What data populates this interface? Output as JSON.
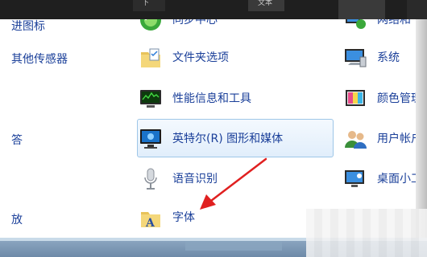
{
  "header": {
    "partial_labels": [
      "下",
      "文本"
    ]
  },
  "left_column": {
    "items": [
      {
        "label": "进图标"
      },
      {
        "label": "其他传感器"
      },
      {
        "label": "答"
      },
      {
        "label": "放"
      }
    ]
  },
  "middle_column": {
    "items": [
      {
        "label": "同步中心",
        "icon": "sync-center-icon"
      },
      {
        "label": "文件夹选项",
        "icon": "folder-options-icon"
      },
      {
        "label": "性能信息和工具",
        "icon": "performance-monitor-icon"
      },
      {
        "label": "英特尔(R) 图形和媒体",
        "icon": "intel-graphics-icon"
      },
      {
        "label": "语音识别",
        "icon": "microphone-icon"
      },
      {
        "label": "字体",
        "icon": "fonts-folder-icon"
      }
    ]
  },
  "right_column": {
    "items": [
      {
        "label": "网络和",
        "icon": "network-icon"
      },
      {
        "label": "系统",
        "icon": "system-computer-icon"
      },
      {
        "label": "颜色管理",
        "icon": "color-management-icon"
      },
      {
        "label": "用户帐户",
        "icon": "user-accounts-icon"
      },
      {
        "label": "桌面小工",
        "icon": "desktop-gadgets-icon"
      }
    ]
  },
  "colors": {
    "link": "#1a3f99",
    "arrow": "#e02020",
    "highlight_border": "#9ec6e8"
  }
}
